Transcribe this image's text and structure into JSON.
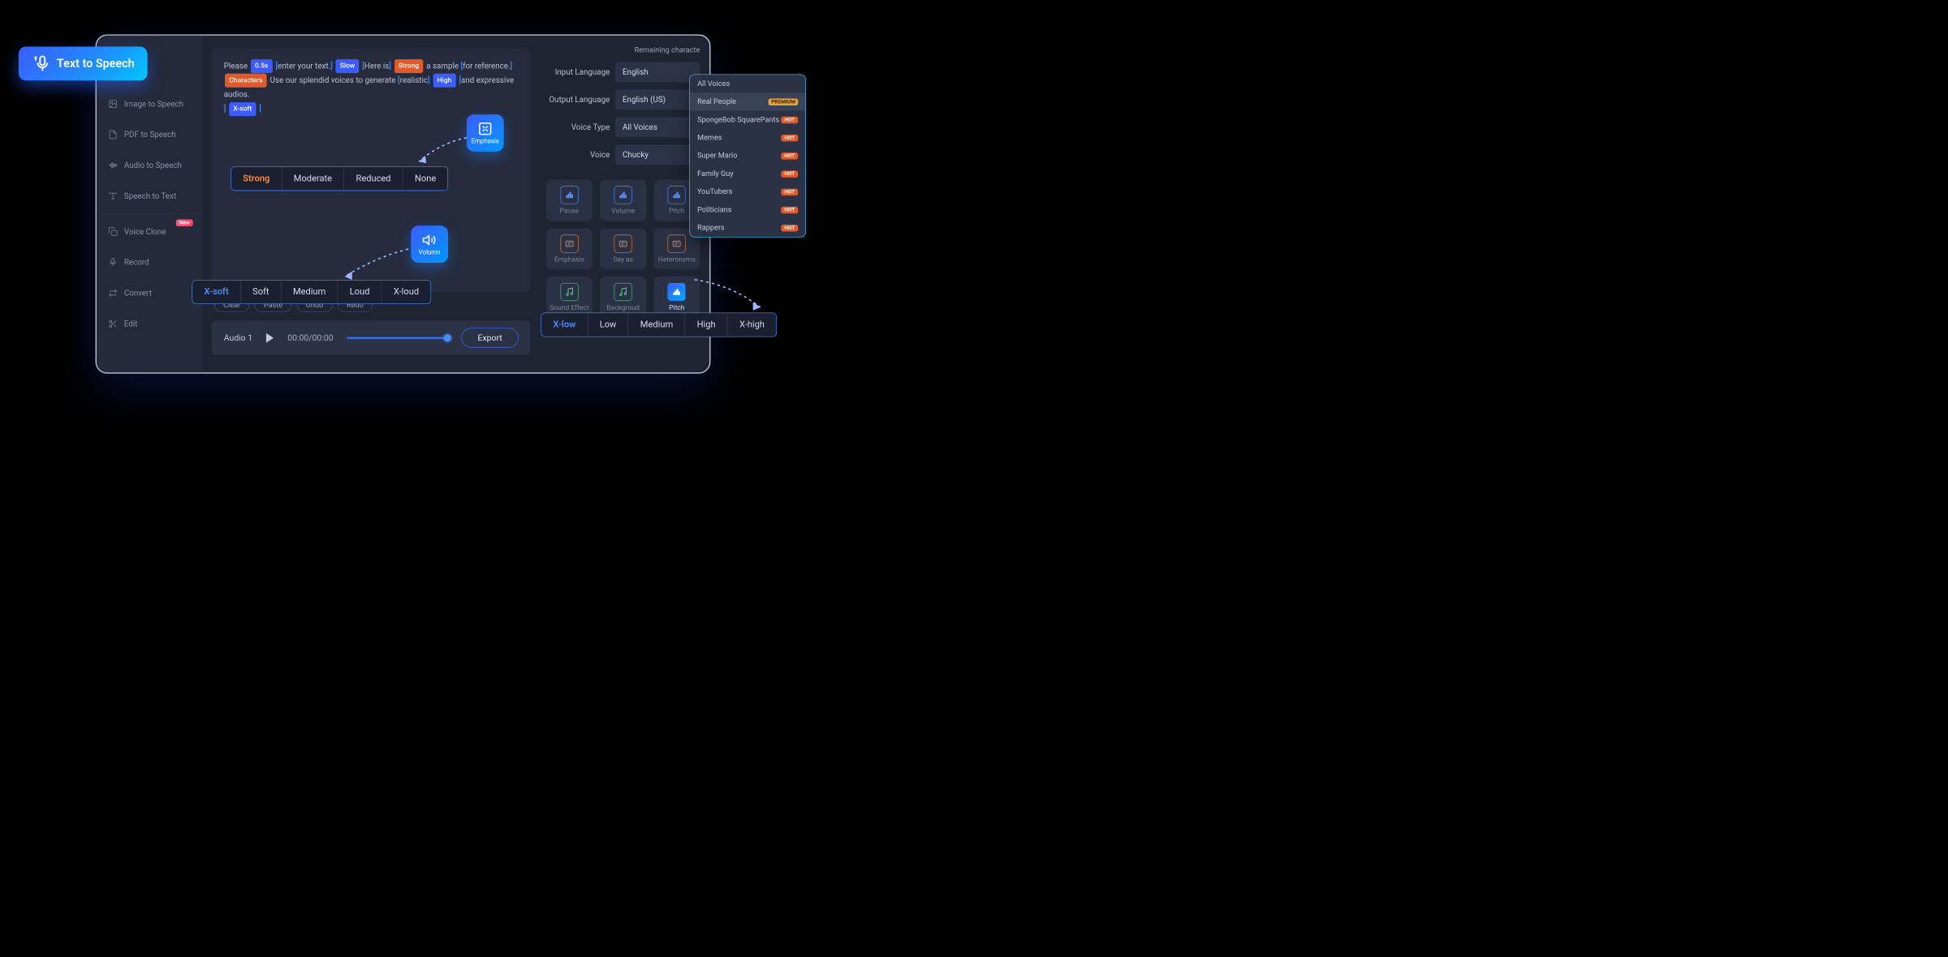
{
  "badge": {
    "label": "Text  to Speech"
  },
  "sidebar": {
    "items": [
      {
        "label": "Image to Speech"
      },
      {
        "label": "PDF to Speech"
      },
      {
        "label": "Audio to Speech"
      },
      {
        "label": "Speech to Text"
      },
      {
        "label": "Voice Clone",
        "badge": "New"
      },
      {
        "label": "Record"
      },
      {
        "label": "Convert"
      },
      {
        "label": "Edit"
      }
    ]
  },
  "remaining_label": "Remaining characte",
  "editor": {
    "word_please": "Please",
    "tag_pause": "0.5s",
    "frag_enter": "enter your text.",
    "tag_slow": "Slow",
    "frag_here": "Here is",
    "tag_strong": "Strong",
    "frag_sample": " a sample ",
    "frag_ref": "for reference.",
    "tag_chars": "Characters",
    "frag_use": " Use our splendid voices to generate ",
    "frag_realistic": "realistic",
    "tag_high": "High",
    "frag_expressive": "and expressive audios.",
    "tag_xsoft": "X-soft"
  },
  "actions": {
    "clear": "Clear",
    "paste": "Paste",
    "undo": "Undo",
    "redo": "Redo"
  },
  "audio": {
    "title": "Audio 1",
    "time": "00:00/00:00",
    "export": "Export"
  },
  "settings": {
    "input_lang_label": "Input Language",
    "input_lang_value": "English",
    "output_lang_label": "Output Language",
    "output_lang_value": "English (US)",
    "voice_type_label": "Voice Type",
    "voice_type_value": "All Voices",
    "voice_label": "Voice",
    "voice_value": "Chucky"
  },
  "effects": [
    {
      "label": "Pause",
      "color": "blue"
    },
    {
      "label": "Volume",
      "color": "blue"
    },
    {
      "label": "Pitch",
      "color": "blue"
    },
    {
      "label": "Emphasis",
      "color": "orange"
    },
    {
      "label": "Say as",
      "color": "orange"
    },
    {
      "label": "Heteronyms",
      "color": "orange"
    },
    {
      "label": "Sound Effect",
      "color": "green"
    },
    {
      "label": "Backgroud Music",
      "color": "green"
    },
    {
      "label": "Pitch",
      "color": "blue",
      "active": true
    }
  ],
  "float": {
    "emphasis": "Emphasis",
    "volumn": "Volumn",
    "pitch": "Pitch"
  },
  "emphasis_opts": [
    "Strong",
    "Moderate",
    "Reduced",
    "None"
  ],
  "volume_opts": [
    "X-soft",
    "Soft",
    "Medium",
    "Loud",
    "X-loud"
  ],
  "pitch_opts": [
    "X-low",
    "Low",
    "Medium",
    "High",
    "X-high"
  ],
  "voice_dropdown": [
    {
      "label": "All Voices"
    },
    {
      "label": "Real People",
      "tag": "PREMIUM",
      "selected": true
    },
    {
      "label": "SpongeBob SquarePants",
      "tag": "HOT"
    },
    {
      "label": "Memes",
      "tag": "HOT"
    },
    {
      "label": "Super Mario",
      "tag": "HOT"
    },
    {
      "label": "Family Guy",
      "tag": "HOT"
    },
    {
      "label": "YouTubers",
      "tag": "HOT"
    },
    {
      "label": "Politicians",
      "tag": "HOT"
    },
    {
      "label": "Rappers",
      "tag": "HOT"
    }
  ]
}
